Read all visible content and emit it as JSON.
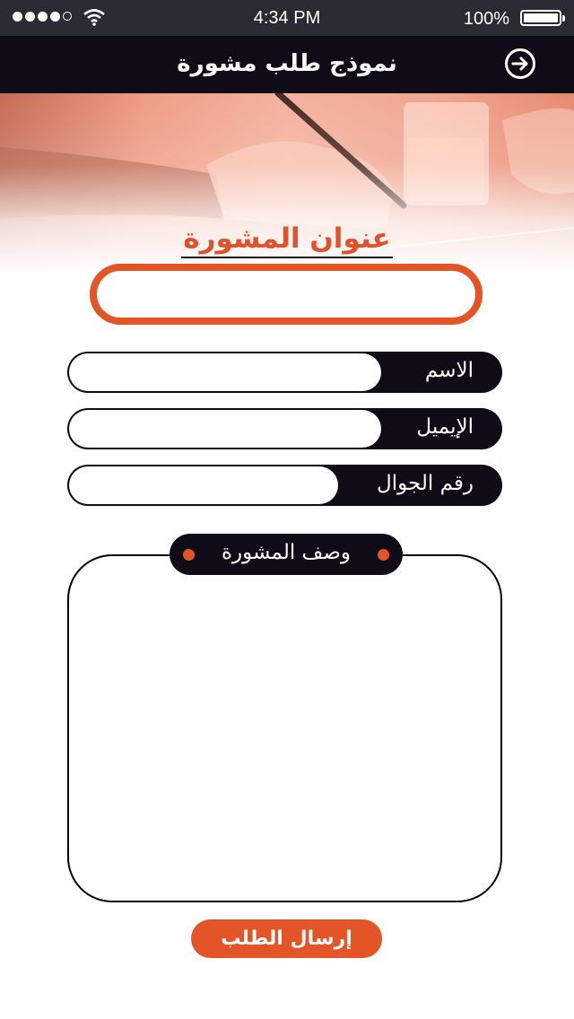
{
  "status_bar": {
    "time": "4:34 PM",
    "battery_percent": "100%",
    "signal_bars_filled": 4,
    "signal_bars_total": 5,
    "icons": [
      "signal-icon",
      "wifi-icon",
      "battery-icon"
    ]
  },
  "nav": {
    "title": "نموذج طلب مشورة",
    "back_icon": "arrow-right-circle-icon"
  },
  "form": {
    "section_title": "عنوان المشورة",
    "title_value": "",
    "fields": [
      {
        "label": "الاسم",
        "value": ""
      },
      {
        "label": "الإيميل",
        "value": ""
      },
      {
        "label": "رقم الجوال",
        "value": ""
      }
    ],
    "description_label": "وصف المشورة",
    "description_value": "",
    "submit_label": "إرسال الطلب"
  },
  "colors": {
    "accent": "#e35427",
    "dark": "#0f0b17",
    "status_bar": "#2b2b33"
  }
}
